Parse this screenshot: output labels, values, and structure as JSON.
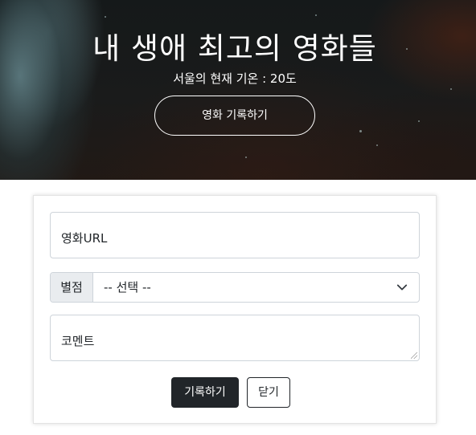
{
  "hero": {
    "title": "내 생애 최고의 영화들",
    "weather": "서울의 현재 기온 : 20도",
    "record_button": "영화 기록하기"
  },
  "form": {
    "url_placeholder": "영화URL",
    "rating_label": "별점",
    "rating_selected": "-- 선택 --",
    "comment_placeholder": "코멘트",
    "save_button": "기록하기",
    "close_button": "닫기"
  }
}
